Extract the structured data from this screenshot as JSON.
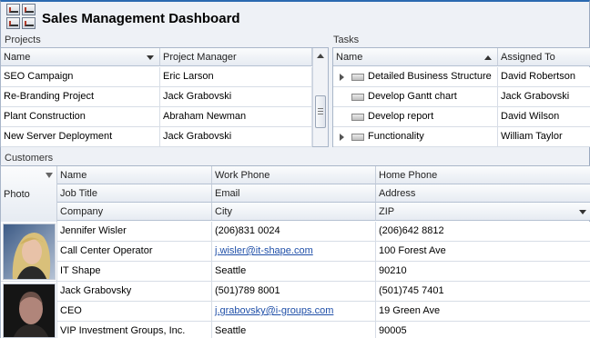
{
  "app": {
    "title": "Sales Management Dashboard"
  },
  "projects": {
    "label": "Projects",
    "columns": [
      "Name",
      "Project Manager"
    ],
    "rows": [
      [
        "SEO Campaign",
        "Eric Larson"
      ],
      [
        "Re-Branding Project",
        "Jack Grabovski"
      ],
      [
        "Plant Construction",
        "Abraham Newman"
      ],
      [
        "New Server Deployment",
        "Jack Grabovski"
      ]
    ]
  },
  "tasks": {
    "label": "Tasks",
    "columns": [
      "Name",
      "Assigned To"
    ],
    "rows": [
      [
        "Detailed Business Structure",
        "David Robertson"
      ],
      [
        "Develop Gantt chart",
        "Jack Grabovski"
      ],
      [
        "Develop report",
        "David Wilson"
      ],
      [
        "Functionality",
        "William Taylor"
      ]
    ]
  },
  "customers": {
    "label": "Customers",
    "photo_header": "Photo",
    "header_rows": [
      [
        "Name",
        "Work Phone",
        "Home Phone"
      ],
      [
        "Job Title",
        "Email",
        "Address"
      ],
      [
        "Company",
        "City",
        "ZIP"
      ]
    ],
    "records": [
      {
        "name": "Jennifer Wisler",
        "work_phone": "(206)831 0024",
        "home_phone": "(206)642 8812",
        "job_title": "Call Center Operator",
        "email": "j.wisler@it-shape.com",
        "address": "100 Forest Ave",
        "company": "IT Shape",
        "city": "Seattle",
        "zip": "90210"
      },
      {
        "name": "Jack Grabovsky",
        "work_phone": "(501)789 8001",
        "home_phone": "(501)745 7401",
        "job_title": "CEO",
        "email": "j.grabovsky@i-groups.com",
        "address": "19 Green Ave",
        "company": "VIP Investment Groups, Inc.",
        "city": "Seattle",
        "zip": "90005"
      }
    ]
  },
  "colors": {
    "accent": "#2b6ab0",
    "link": "#1f4fa8"
  }
}
